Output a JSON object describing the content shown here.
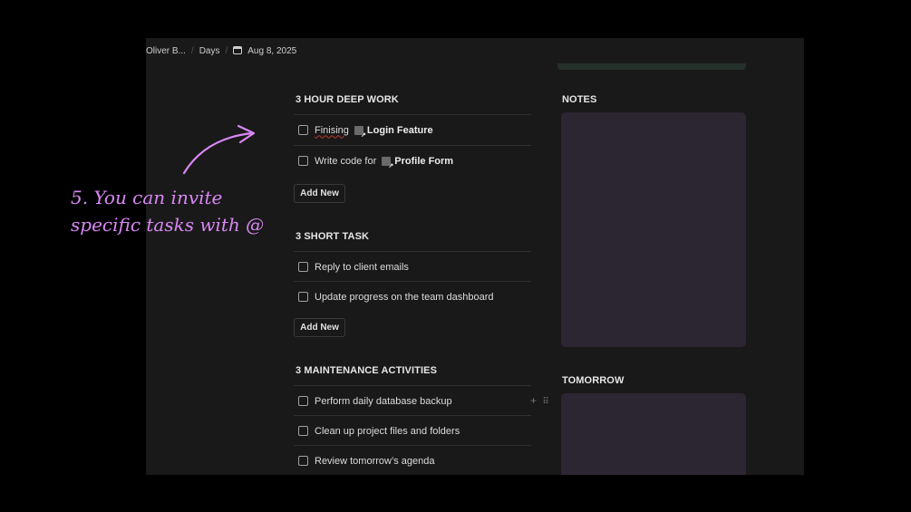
{
  "breadcrumb": {
    "items": [
      "Oliver B...",
      "Days"
    ],
    "date": "Aug 8, 2025"
  },
  "sections": {
    "deep_work": {
      "title": "3 HOUR DEEP WORK",
      "tasks": [
        {
          "prefix": "Finising",
          "mention": "Login Feature"
        },
        {
          "prefix": "Write code for",
          "mention": "Profile Form"
        }
      ],
      "add_label": "Add New"
    },
    "short_task": {
      "title": "3 SHORT TASK",
      "tasks": [
        "Reply to client emails",
        "Update progress on the team dashboard"
      ],
      "add_label": "Add New"
    },
    "maintenance": {
      "title": "3 MAINTENANCE ACTIVITIES",
      "tasks": [
        "Perform daily database backup",
        "Clean up project files and folders",
        "Review tomorrow’s agenda"
      ]
    }
  },
  "notes": {
    "title": "NOTES"
  },
  "tomorrow": {
    "title": "TOMORROW"
  },
  "annotation": {
    "line1": "5. You can invite",
    "line2": "specific tasks with @"
  },
  "colors": {
    "annotation": "#d987f5",
    "panel": "#2c2532",
    "background": "#191919"
  }
}
